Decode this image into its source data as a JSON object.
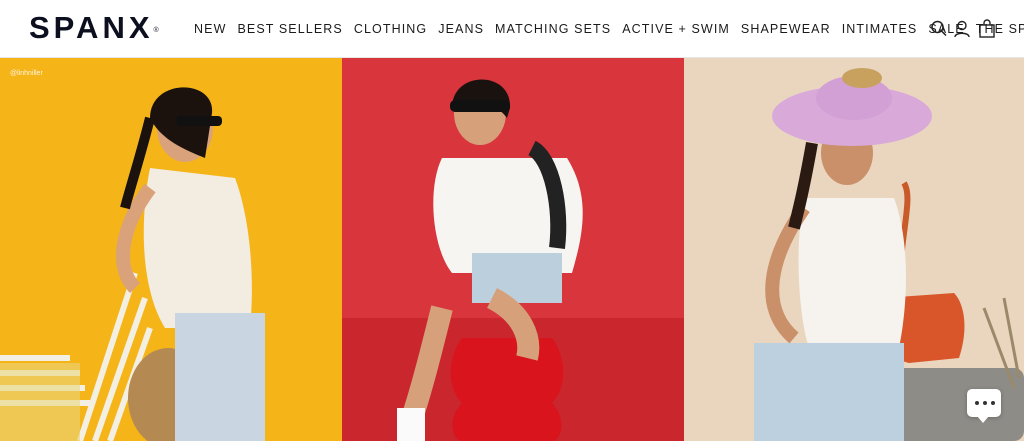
{
  "header": {
    "logo": "SPANX",
    "logo_mark": "®",
    "nav": [
      {
        "label": "NEW"
      },
      {
        "label": "BEST SELLERS"
      },
      {
        "label": "CLOTHING"
      },
      {
        "label": "JEANS"
      },
      {
        "label": "MATCHING SETS"
      },
      {
        "label": "ACTIVE + SWIM"
      },
      {
        "label": "SHAPEWEAR"
      },
      {
        "label": "INTIMATES"
      },
      {
        "label": "SALE"
      },
      {
        "label": "THE SPANX"
      }
    ],
    "icons": [
      "search-icon",
      "account-icon",
      "cart-icon"
    ]
  },
  "hero": {
    "photo_credit": "@linhniller",
    "panels": [
      {
        "name": "yellow",
        "background": "#f5b418"
      },
      {
        "name": "red",
        "background": "#d8353c"
      },
      {
        "name": "beige",
        "background": "#ead6bf"
      }
    ]
  },
  "chat": {
    "icon": "chat-bubble-icon"
  },
  "colors": {
    "text": "#111111",
    "logo": "#0b0f1e"
  }
}
